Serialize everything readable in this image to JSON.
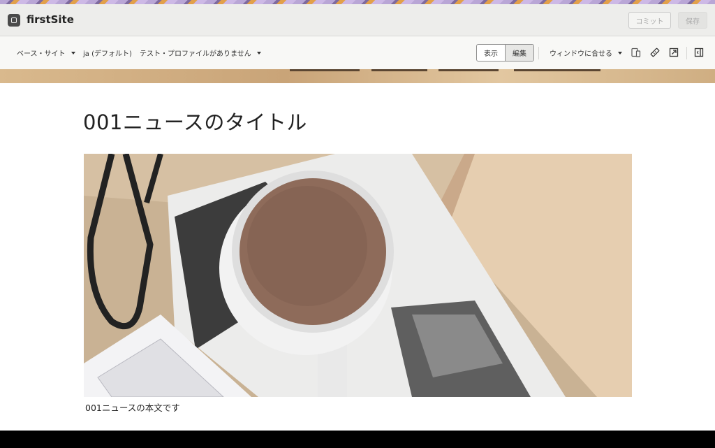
{
  "app": {
    "site_name": "firstSite",
    "commit_label": "コミット",
    "save_label": "保存"
  },
  "toolbar": {
    "base_site": "ベース・サイト",
    "language": "ja (デフォルト)",
    "test_profile": "テスト・プロファイルがありません",
    "view_label": "表示",
    "edit_label": "編集",
    "fit_window": "ウィンドウに合せる",
    "icons": [
      "devices-icon",
      "ruler-icon",
      "open-external-icon",
      "panel-toggle-icon"
    ]
  },
  "content": {
    "title": "001ニュースのタイトル",
    "body": "001ニュースの本文です",
    "image": "coffee-cup-photo"
  }
}
